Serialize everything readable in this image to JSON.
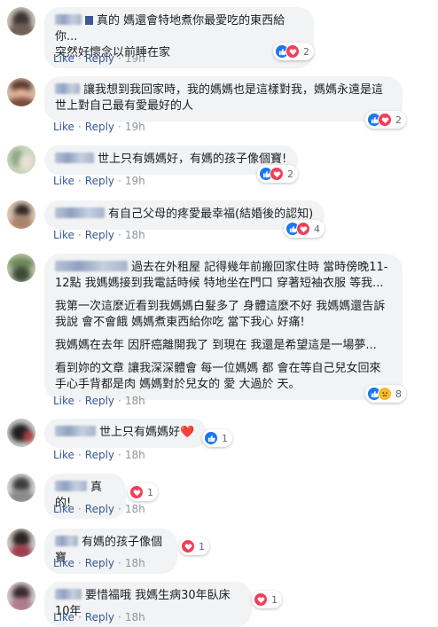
{
  "labels": {
    "like": "Like",
    "reply": "Reply",
    "separator": "·"
  },
  "colors": {
    "bubble": "#f2f3f5",
    "link": "#385898",
    "like_reaction": "#1877f2",
    "love_reaction": "#f33e58",
    "sad_reaction": "#f7b928"
  },
  "comments": [
    {
      "lines": [
        "真的 媽還會特地煮你最愛吃的東西給你...",
        "突然好懷念以前睡在家"
      ],
      "time": "19h",
      "reactions": [
        "like-icon",
        "love-icon"
      ],
      "count": "2"
    },
    {
      "lines": [
        "讓我想到我回家時，我的媽媽也是這樣對我，媽媽永遠是這世上對自己最有愛最好的人"
      ],
      "time": "19h",
      "reactions": [
        "like-icon",
        "love-icon"
      ],
      "count": "2"
    },
    {
      "lines": [
        "世上只有媽媽好，有媽的孩子像個寶!"
      ],
      "time": "19h",
      "reactions": [
        "like-icon",
        "love-icon"
      ],
      "count": "2"
    },
    {
      "lines": [
        "有自己父母的疼愛最幸福(結婚後的認知)"
      ],
      "time": "18h",
      "reactions": [
        "like-icon",
        "love-icon"
      ],
      "count": "4"
    },
    {
      "lines": [
        "過去在外租屋 記得幾年前搬回家住時 當時傍晚11-12點 我媽媽接到我電話時候 特地坐在門口 穿著短袖衣服 等我...",
        "我第一次這麼近看到我媽媽白髮多了 身體這麼不好 我媽媽還告訴我說 會不會餓 媽媽煮東西給你吃 當下我心 好痛!",
        "我媽媽在去年 因肝癌離開我了 到現在 我還是希望這是一場夢...",
        "看到妳的文章 讓我深深體會 每一位媽媽 都 會在等自己兒女回來 手心手背都是肉 媽媽對於兒女的 愛 大過於 天。"
      ],
      "time": "18h",
      "reactions": [
        "like-icon",
        "sad-icon"
      ],
      "count": "8"
    },
    {
      "lines": [
        "世上只有媽媽好❤️"
      ],
      "time": "18h",
      "reactions": [
        "like-icon"
      ],
      "count": "1"
    },
    {
      "lines": [
        "真的!"
      ],
      "time": "18h",
      "reactions": [
        "love-icon"
      ],
      "count": "1"
    },
    {
      "lines": [
        "有媽的孩子像個寶"
      ],
      "time": "18h",
      "reactions": [
        "love-icon"
      ],
      "count": "1"
    },
    {
      "lines": [
        "要惜福哦 我媽生病30年臥床10年"
      ],
      "time": "18h",
      "reactions": [
        "love-icon"
      ],
      "count": "1"
    }
  ]
}
